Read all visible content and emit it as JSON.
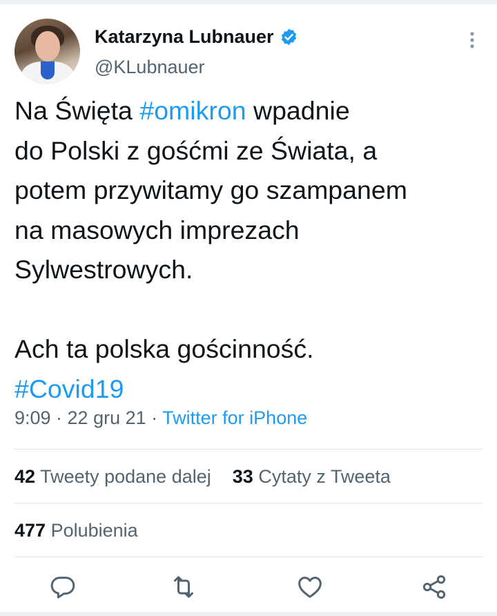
{
  "author": {
    "name": "Katarzyna Lubnauer",
    "handle": "@KLubnauer",
    "verified_color": "#1d9bf0"
  },
  "tweet": {
    "line1_a": "Na Święta ",
    "line1_tag": "#omikron",
    "line1_b": " wpadnie",
    "body": "do Polski z gośćmi ze Świata, a\npotem przywitamy go szampanem\nna masowych imprezach\nSylwestrowych.\n\nAch ta polska gościnność.",
    "hashtag2": "#Covid19"
  },
  "meta": {
    "time_date": "9:09 · 22 gru 21 · ",
    "source": "Twitter for iPhone"
  },
  "stats": {
    "retweets_count": "42",
    "retweets_label": "Tweety podane dalej",
    "quotes_count": "33",
    "quotes_label": "Cytaty z Tweeta",
    "likes_count": "477",
    "likes_label": "Polubienia"
  },
  "icons": {
    "reply": "reply-icon",
    "retweet": "retweet-icon",
    "like": "heart-icon",
    "share": "share-icon",
    "more": "more-vertical-icon"
  },
  "colors": {
    "accent": "#1d9bf0",
    "secondary_text": "#536471",
    "primary_text": "#0f1419"
  }
}
